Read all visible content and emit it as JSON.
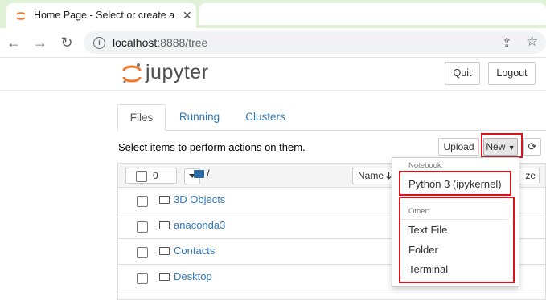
{
  "browser": {
    "tab_title": "Home Page - Select or create a n",
    "url_host": "localhost",
    "url_rest": ":8888/tree"
  },
  "header": {
    "logo_text": "jupyter",
    "quit_label": "Quit",
    "logout_label": "Logout"
  },
  "tabs": [
    "Files",
    "Running",
    "Clusters"
  ],
  "toolbar": {
    "select_text": "Select items to perform actions on them.",
    "upload_label": "Upload",
    "new_label": "New",
    "refresh_icon": "refresh-icon"
  },
  "list_header": {
    "selected_count": "0",
    "root_path": "/",
    "name_sort_label": "Name",
    "size_label_partial": "ze"
  },
  "files": [
    "3D Objects",
    "anaconda3",
    "Contacts",
    "Desktop"
  ],
  "new_menu": {
    "notebook_header": "Notebook:",
    "python_kernel": "Python 3 (ipykernel)",
    "other_header": "Other:",
    "text_file": "Text File",
    "folder": "Folder",
    "terminal": "Terminal"
  },
  "colors": {
    "link": "#337ab7",
    "highlight_box": "#d9141e",
    "jupyter_orange": "#f37726",
    "tabbar_bg": "#dff2d8"
  }
}
